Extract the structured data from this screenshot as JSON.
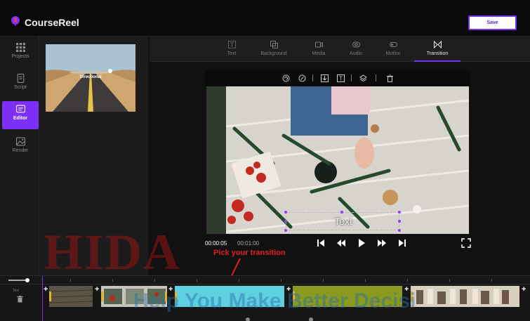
{
  "app": {
    "name": "CourseReel",
    "save_label": "Save"
  },
  "sidebar": {
    "items": [
      {
        "label": "Projects",
        "icon": "grid-icon",
        "active": false
      },
      {
        "label": "Script",
        "icon": "document-icon",
        "active": false
      },
      {
        "label": "Editor",
        "icon": "editor-icon",
        "active": true
      },
      {
        "label": "Render",
        "icon": "image-icon",
        "active": false
      }
    ]
  },
  "media": {
    "thumbnail_label": "Directional"
  },
  "tabs": [
    {
      "label": "Text",
      "icon": "text-icon",
      "active": false
    },
    {
      "label": "Background",
      "icon": "background-icon",
      "active": false
    },
    {
      "label": "Media",
      "icon": "media-icon",
      "active": false
    },
    {
      "label": "Audio",
      "icon": "audio-icon",
      "active": false
    },
    {
      "label": "Motion",
      "icon": "motion-icon",
      "active": false
    },
    {
      "label": "Transition",
      "icon": "transition-icon",
      "active": true
    }
  ],
  "video_toolbar": [
    "replace-icon",
    "crop-icon",
    "download-icon",
    "text-box-icon",
    "layers-icon",
    "trash-icon"
  ],
  "player": {
    "overlay_text": "Text",
    "current_time": "00:00:05",
    "total_time": "00:01:00",
    "controls": [
      "skip-start-icon",
      "rewind-icon",
      "play-icon",
      "fast-forward-icon",
      "skip-end-icon",
      "fullscreen-icon"
    ]
  },
  "annotation": "Pick your transition",
  "watermark": {
    "big": "HIDA",
    "small": "Help You Make Better Decisi"
  },
  "timeline": {
    "track_label": "Text",
    "clips": [
      {
        "name": "clip-wood",
        "color": "#5c5348"
      },
      {
        "name": "clip-flowers",
        "color": "#4a5346"
      },
      {
        "name": "clip-transition",
        "color": "#5fd0e0"
      },
      {
        "name": "clip-olive",
        "color": "#8a9a1e"
      },
      {
        "name": "clip-people",
        "color": "#c9bfae"
      }
    ]
  },
  "colors": {
    "accent": "#7b2ff7",
    "annotation": "#e01f1f",
    "selected_clip": "#5fd0e0"
  }
}
